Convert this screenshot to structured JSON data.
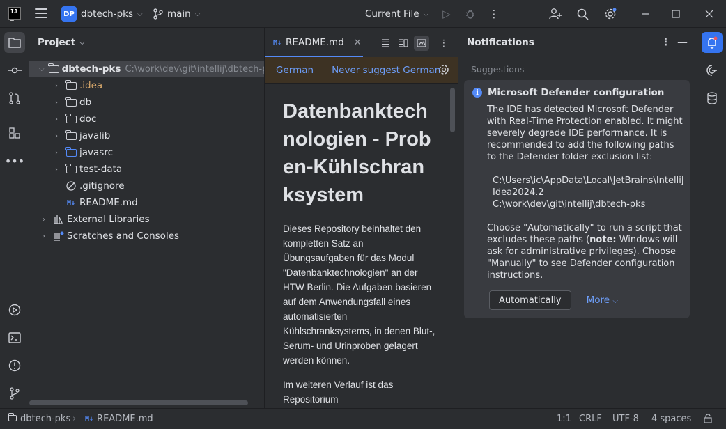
{
  "titlebar": {
    "project_badge": "DP",
    "project_name": "dbtech-pks",
    "branch": "main",
    "run_config": "Current File"
  },
  "project_panel": {
    "title": "Project",
    "root": {
      "name": "dbtech-pks",
      "path": "C:\\work\\dev\\git\\intellij\\dbtech-pks"
    },
    "items": [
      {
        "name": ".idea"
      },
      {
        "name": "db"
      },
      {
        "name": "doc"
      },
      {
        "name": "javalib"
      },
      {
        "name": "javasrc"
      },
      {
        "name": "test-data"
      },
      {
        "name": ".gitignore"
      },
      {
        "name": "README.md"
      }
    ],
    "external_libraries": "External Libraries",
    "scratches": "Scratches and Consoles"
  },
  "editor": {
    "tab_label": "README.md",
    "md_badge": "M↓",
    "suggest_german": "German",
    "suggest_never": "Never suggest German",
    "heading": "Datenbanktechnologien - Proben-Kühlschranksystem",
    "paragraph": "Dieses Repository beinhaltet den kompletten Satz an Übungsaufgaben für das Modul \"Datenbanktechnologien\" an der HTW Berlin. Die Aufgaben basieren auf dem Anwendungsfall eines automatisierten Kühlschranksystems, in denen Blut-, Serum- und Urinproben gelagert werden können.",
    "paragraph2": "Im weiteren Verlauf ist das Repositorium"
  },
  "notifications": {
    "title": "Notifications",
    "section": "Suggestions",
    "card_title": "Microsoft Defender configuration",
    "body1": "The IDE has detected Microsoft Defender with Real-Time Protection enabled. It might severely degrade IDE performance. It is recommended to add the following paths to the Defender folder exclusion list:",
    "path1": "C:\\Users\\ic\\AppData\\Local\\JetBrains\\IntelliJIdea2024.2",
    "path2": "C:\\work\\dev\\git\\intellij\\dbtech-pks",
    "body2_pre": "Choose \"Automatically\" to run a script that excludes these paths (",
    "body2_note": "note:",
    "body2_post": " Windows will ask for administrative privileges). Choose \"Manually\" to see Defender configuration instructions.",
    "btn_auto": "Automatically",
    "more": "More"
  },
  "statusbar": {
    "project": "dbtech-pks",
    "file": "README.md",
    "position": "1:1",
    "line_sep": "CRLF",
    "encoding": "UTF-8",
    "indent": "4 spaces"
  },
  "colors": {
    "accent": "#3574f0",
    "link": "#6d9df7",
    "suggest_bg": "#3d3223",
    "idea_folder": "#d5a66a"
  }
}
